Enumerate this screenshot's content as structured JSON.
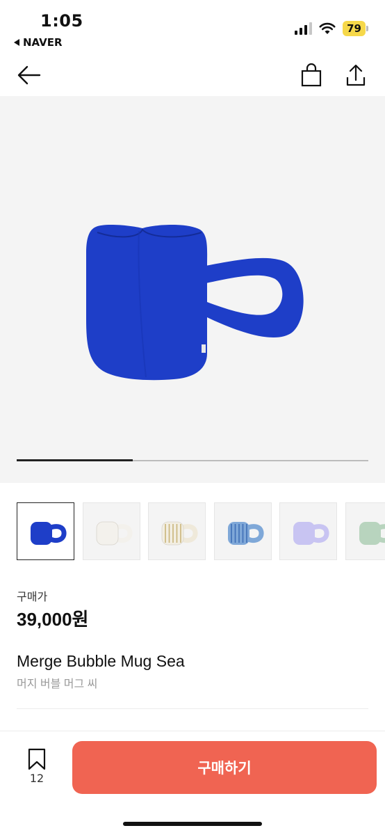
{
  "status_bar": {
    "time": "1:05",
    "back_app": "NAVER",
    "battery": "79"
  },
  "nav": {
    "back_icon": "arrow-left-icon",
    "bag_icon": "shopping-bag-icon",
    "share_icon": "share-icon"
  },
  "gallery": {
    "progress": 0.33,
    "thumbnails": [
      {
        "color": "#1e3ec8",
        "handle": "#1e3ec8",
        "pattern": "solid",
        "selected": true
      },
      {
        "color": "#f3f1ec",
        "handle": "#f3f1ec",
        "pattern": "solid",
        "selected": false
      },
      {
        "color": "#f2eee2",
        "handle": "#efe9da",
        "pattern": "stripes-beige",
        "selected": false
      },
      {
        "color": "#7fa8d8",
        "handle": "#7fa8d8",
        "pattern": "stripes-blue",
        "selected": false
      },
      {
        "color": "#c8c4f2",
        "handle": "#c8c4f2",
        "pattern": "solid",
        "selected": false
      },
      {
        "color": "#b8d4be",
        "handle": "#b8d4be",
        "pattern": "solid",
        "selected": false
      }
    ]
  },
  "product": {
    "price_label": "구매가",
    "price": "39,000원",
    "title": "Merge Bubble Mug Sea",
    "subtitle": "머지 버블 머그 씨",
    "image_color": "#1e3ec8"
  },
  "bottom": {
    "bookmark_count": "12",
    "buy_label": "구매하기",
    "buy_color": "#f06452"
  }
}
